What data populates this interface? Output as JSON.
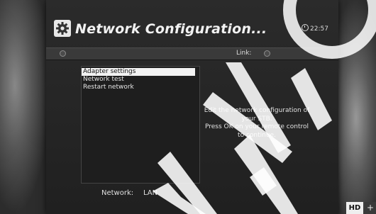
{
  "header": {
    "title": "Network Configuration...",
    "icon": "gear-icon",
    "clock": "22:57"
  },
  "status": {
    "link_label": "Link:"
  },
  "menu": {
    "items": [
      {
        "label": "Adapter settings",
        "selected": true
      },
      {
        "label": "Network test",
        "selected": false
      },
      {
        "label": "Restart network",
        "selected": false
      }
    ]
  },
  "help": {
    "line1": "Edit the network configuration of",
    "line2": "your STB.",
    "line3": "Press OK on your remote control",
    "line4": "to continue."
  },
  "footer": {
    "network_label": "Network:",
    "network_value": "LAN",
    "hd_badge": "HD",
    "plus_badge": "+"
  },
  "colors": {
    "highlight": "#f2f2f2",
    "watermark": "#ffffff"
  }
}
